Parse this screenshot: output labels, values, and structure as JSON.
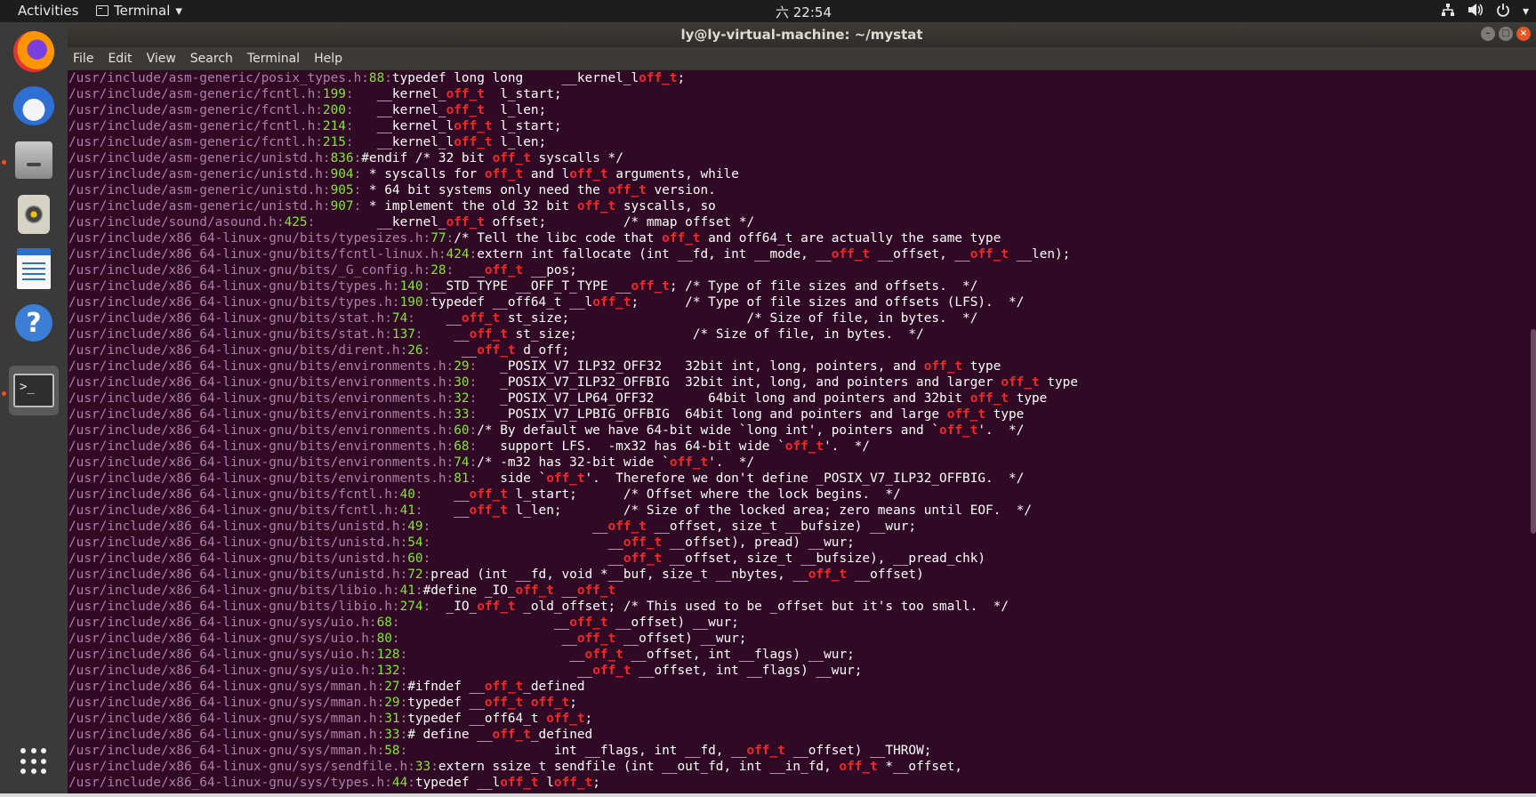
{
  "topbar": {
    "activities": "Activities",
    "app_name": "Terminal",
    "app_chevron": "▾",
    "clock": "六 22:54",
    "tray_icons": [
      "network-icon",
      "volume-icon",
      "power-icon"
    ],
    "tray_chevron": "▾"
  },
  "dock": {
    "items": [
      {
        "name": "firefox",
        "icon": "firefox-icon"
      },
      {
        "name": "thunderbird",
        "icon": "thunderbird-icon"
      },
      {
        "name": "files",
        "icon": "files-icon"
      },
      {
        "name": "rhythmbox",
        "icon": "rhythmbox-icon"
      },
      {
        "name": "libreoffice-writer",
        "icon": "writer-icon"
      },
      {
        "name": "help",
        "icon": "help-icon"
      },
      {
        "name": "terminal",
        "icon": "terminal-icon",
        "active": true
      }
    ],
    "show_apps_icon": "grid-icon"
  },
  "window": {
    "title": "ly@ly-virtual-machine: ~/mystat",
    "menu": [
      "File",
      "Edit",
      "View",
      "Search",
      "Terminal",
      "Help"
    ]
  },
  "colors": {
    "background": "#300a24",
    "path": "#ad7fa8",
    "line_number": "#8ae234",
    "highlight": "#ef2929",
    "text": "#ffffff"
  },
  "terminal": {
    "highlight_term": "off_t",
    "lines": [
      {
        "path": "/usr/include/asm-generic/posix_types.h",
        "num": "88",
        "code": "typedef long long     __kernel_loff_t;"
      },
      {
        "path": "/usr/include/asm-generic/fcntl.h",
        "num": "199",
        "code": "   __kernel_off_t  l_start;"
      },
      {
        "path": "/usr/include/asm-generic/fcntl.h",
        "num": "200",
        "code": "   __kernel_off_t  l_len;"
      },
      {
        "path": "/usr/include/asm-generic/fcntl.h",
        "num": "214",
        "code": "   __kernel_loff_t l_start;"
      },
      {
        "path": "/usr/include/asm-generic/fcntl.h",
        "num": "215",
        "code": "   __kernel_loff_t l_len;"
      },
      {
        "path": "/usr/include/asm-generic/unistd.h",
        "num": "836",
        "code": "#endif /* 32 bit off_t syscalls */"
      },
      {
        "path": "/usr/include/asm-generic/unistd.h",
        "num": "904",
        "code": " * syscalls for off_t and loff_t arguments, while"
      },
      {
        "path": "/usr/include/asm-generic/unistd.h",
        "num": "905",
        "code": " * 64 bit systems only need the off_t version."
      },
      {
        "path": "/usr/include/asm-generic/unistd.h",
        "num": "907",
        "code": " * implement the old 32 bit off_t syscalls, so"
      },
      {
        "path": "/usr/include/sound/asound.h",
        "num": "425",
        "code": "        __kernel_off_t offset;          /* mmap offset */"
      },
      {
        "path": "/usr/include/x86_64-linux-gnu/bits/typesizes.h",
        "num": "77",
        "code": "/* Tell the libc code that off_t and off64_t are actually the same type"
      },
      {
        "path": "/usr/include/x86_64-linux-gnu/bits/fcntl-linux.h",
        "num": "424",
        "code": "extern int fallocate (int __fd, int __mode, __off_t __offset, __off_t __len);"
      },
      {
        "path": "/usr/include/x86_64-linux-gnu/bits/_G_config.h",
        "num": "28",
        "code": "  __off_t __pos;"
      },
      {
        "path": "/usr/include/x86_64-linux-gnu/bits/types.h",
        "num": "140",
        "code": "__STD_TYPE __OFF_T_TYPE __off_t; /* Type of file sizes and offsets.  */"
      },
      {
        "path": "/usr/include/x86_64-linux-gnu/bits/types.h",
        "num": "190",
        "code": "typedef __off64_t __loff_t;      /* Type of file sizes and offsets (LFS).  */"
      },
      {
        "path": "/usr/include/x86_64-linux-gnu/bits/stat.h",
        "num": "74",
        "code": "    __off_t st_size;                       /* Size of file, in bytes.  */"
      },
      {
        "path": "/usr/include/x86_64-linux-gnu/bits/stat.h",
        "num": "137",
        "code": "    __off_t st_size;               /* Size of file, in bytes.  */"
      },
      {
        "path": "/usr/include/x86_64-linux-gnu/bits/dirent.h",
        "num": "26",
        "code": "    __off_t d_off;"
      },
      {
        "path": "/usr/include/x86_64-linux-gnu/bits/environments.h",
        "num": "29",
        "code": "   _POSIX_V7_ILP32_OFF32   32bit int, long, pointers, and off_t type"
      },
      {
        "path": "/usr/include/x86_64-linux-gnu/bits/environments.h",
        "num": "30",
        "code": "   _POSIX_V7_ILP32_OFFBIG  32bit int, long, and pointers and larger off_t type"
      },
      {
        "path": "/usr/include/x86_64-linux-gnu/bits/environments.h",
        "num": "32",
        "code": "   _POSIX_V7_LP64_OFF32       64bit long and pointers and 32bit off_t type"
      },
      {
        "path": "/usr/include/x86_64-linux-gnu/bits/environments.h",
        "num": "33",
        "code": "   _POSIX_V7_LPBIG_OFFBIG  64bit long and pointers and large off_t type"
      },
      {
        "path": "/usr/include/x86_64-linux-gnu/bits/environments.h",
        "num": "60",
        "code": "/* By default we have 64-bit wide `long int', pointers and `off_t'.  */"
      },
      {
        "path": "/usr/include/x86_64-linux-gnu/bits/environments.h",
        "num": "68",
        "code": "   support LFS.  -mx32 has 64-bit wide `off_t'.  */"
      },
      {
        "path": "/usr/include/x86_64-linux-gnu/bits/environments.h",
        "num": "74",
        "code": "/* -m32 has 32-bit wide `off_t'.  */"
      },
      {
        "path": "/usr/include/x86_64-linux-gnu/bits/environments.h",
        "num": "81",
        "code": "   side `off_t'.  Therefore we don't define _POSIX_V7_ILP32_OFFBIG.  */"
      },
      {
        "path": "/usr/include/x86_64-linux-gnu/bits/fcntl.h",
        "num": "40",
        "code": "    __off_t l_start;      /* Offset where the lock begins.  */"
      },
      {
        "path": "/usr/include/x86_64-linux-gnu/bits/fcntl.h",
        "num": "41",
        "code": "    __off_t l_len;        /* Size of the locked area; zero means until EOF.  */"
      },
      {
        "path": "/usr/include/x86_64-linux-gnu/bits/unistd.h",
        "num": "49",
        "code": "                     __off_t __offset, size_t __bufsize) __wur;"
      },
      {
        "path": "/usr/include/x86_64-linux-gnu/bits/unistd.h",
        "num": "54",
        "code": "                       __off_t __offset), pread) __wur;"
      },
      {
        "path": "/usr/include/x86_64-linux-gnu/bits/unistd.h",
        "num": "60",
        "code": "                       __off_t __offset, size_t __bufsize), __pread_chk)"
      },
      {
        "path": "/usr/include/x86_64-linux-gnu/bits/unistd.h",
        "num": "72",
        "code": "pread (int __fd, void *__buf, size_t __nbytes, __off_t __offset)"
      },
      {
        "path": "/usr/include/x86_64-linux-gnu/bits/libio.h",
        "num": "41",
        "code": "#define _IO_off_t __off_t"
      },
      {
        "path": "/usr/include/x86_64-linux-gnu/bits/libio.h",
        "num": "274",
        "code": "  _IO_off_t _old_offset; /* This used to be _offset but it's too small.  */"
      },
      {
        "path": "/usr/include/x86_64-linux-gnu/sys/uio.h",
        "num": "68",
        "code": "                    __off_t __offset) __wur;"
      },
      {
        "path": "/usr/include/x86_64-linux-gnu/sys/uio.h",
        "num": "80",
        "code": "                     __off_t __offset) __wur;"
      },
      {
        "path": "/usr/include/x86_64-linux-gnu/sys/uio.h",
        "num": "128",
        "code": "                     __off_t __offset, int __flags) __wur;"
      },
      {
        "path": "/usr/include/x86_64-linux-gnu/sys/uio.h",
        "num": "132",
        "code": "                      __off_t __offset, int __flags) __wur;"
      },
      {
        "path": "/usr/include/x86_64-linux-gnu/sys/mman.h",
        "num": "27",
        "code": "#ifndef __off_t_defined"
      },
      {
        "path": "/usr/include/x86_64-linux-gnu/sys/mman.h",
        "num": "29",
        "code": "typedef __off_t off_t;"
      },
      {
        "path": "/usr/include/x86_64-linux-gnu/sys/mman.h",
        "num": "31",
        "code": "typedef __off64_t off_t;"
      },
      {
        "path": "/usr/include/x86_64-linux-gnu/sys/mman.h",
        "num": "33",
        "code": "# define __off_t_defined"
      },
      {
        "path": "/usr/include/x86_64-linux-gnu/sys/mman.h",
        "num": "58",
        "code": "                   int __flags, int __fd, __off_t __offset) __THROW;"
      },
      {
        "path": "/usr/include/x86_64-linux-gnu/sys/sendfile.h",
        "num": "33",
        "code": "extern ssize_t sendfile (int __out_fd, int __in_fd, off_t *__offset,"
      },
      {
        "path": "/usr/include/x86_64-linux-gnu/sys/types.h",
        "num": "44",
        "code": "typedef __loff_t loff_t;"
      }
    ]
  }
}
